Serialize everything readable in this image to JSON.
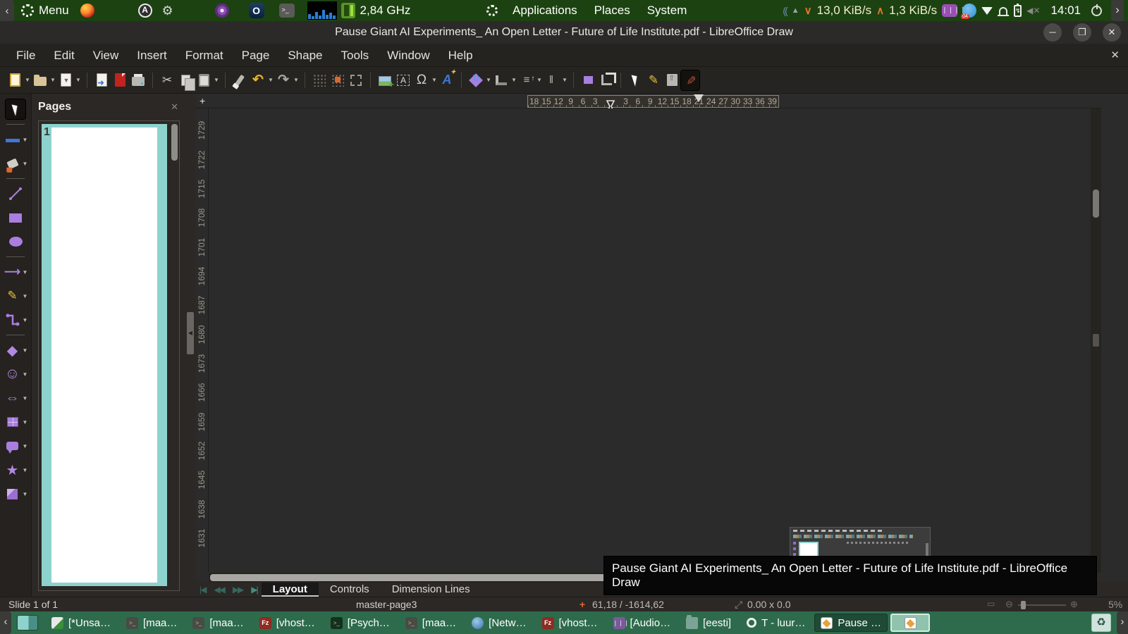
{
  "top_panel": {
    "menu_label": "Menu",
    "cpu_freq": "2,84 GHz",
    "menus": [
      "Applications",
      "Places",
      "System"
    ],
    "net_down": "13,0 KiB/s",
    "net_up": "1,3 KiB/s",
    "clock": "14:01"
  },
  "title_bar": {
    "title": "Pause Giant AI Experiments_ An Open Letter - Future of Life Institute.pdf - LibreOffice Draw"
  },
  "menu_bar": {
    "items": [
      "File",
      "Edit",
      "View",
      "Insert",
      "Format",
      "Page",
      "Shape",
      "Tools",
      "Window",
      "Help"
    ]
  },
  "icons": {
    "chevron_left": "‹",
    "chevron_right": "›",
    "search_letter": "A",
    "gears": "⚙",
    "terminal_prompt": ">_",
    "opera_letter": "O",
    "scissors": "✂",
    "undo": "↶",
    "redo": "↷",
    "omega": "Ω",
    "fontwork_letter": "A",
    "textbox_letter": "A",
    "arrange": "≡",
    "distribute": "‖",
    "pencil": "✎",
    "line_arrow": "⟶",
    "diamond": "◆",
    "smiley": "☺",
    "double_arrow": "⇔",
    "star": "★",
    "mute": "◀✕",
    "close": "✕",
    "minimize": "─",
    "restore": "❐",
    "nav_first": "|◀",
    "nav_prev": "◀◀",
    "nav_next": "▶▶",
    "nav_last": "▶|",
    "filezilla": "Fz",
    "trash": "♻",
    "size_icon": "⤢",
    "pos_cross": "+",
    "zoom_fit": "▭",
    "zoom_minus": "⊖",
    "zoom_plus": "⊕",
    "split_arrow": "◀"
  },
  "rulers": {
    "horizontal": [
      "18",
      "15",
      "12",
      "9",
      "6",
      "3",
      "3",
      "6",
      "9",
      "12",
      "15",
      "18",
      "21",
      "24",
      "27",
      "30",
      "33",
      "36",
      "39"
    ],
    "vertical": [
      "1729",
      "1722",
      "1715",
      "1708",
      "1701",
      "1694",
      "1687",
      "1680",
      "1673",
      "1666",
      "1659",
      "1652",
      "1645",
      "1638",
      "1631"
    ]
  },
  "pages_panel": {
    "title": "Pages",
    "page_number": "1"
  },
  "view_tabs": {
    "items": [
      "Layout",
      "Controls",
      "Dimension Lines"
    ],
    "active": "Layout"
  },
  "status_bar": {
    "slide": "Slide 1 of 1",
    "master": "master-page3",
    "position": "61,18 / -1614,62",
    "size": "0.00 x 0.0",
    "zoom": "5%"
  },
  "tooltip": {
    "text": "Pause Giant AI Experiments_ An Open Letter - Future of Life Institute.pdf - LibreOffice Draw"
  },
  "taskbar": {
    "items": [
      {
        "icon": "text-editor",
        "label": "[*Unsa…"
      },
      {
        "icon": "terminal",
        "label": "[maa…"
      },
      {
        "icon": "terminal",
        "label": "[maa…"
      },
      {
        "icon": "filezilla",
        "label": "[vhost…"
      },
      {
        "icon": "terminal-dark",
        "label": "[Psych…"
      },
      {
        "icon": "terminal",
        "label": "[maa…"
      },
      {
        "icon": "network",
        "label": "[Netw…"
      },
      {
        "icon": "filezilla",
        "label": "[vhost…"
      },
      {
        "icon": "audio",
        "label": "[Audio…"
      },
      {
        "icon": "folder",
        "label": "[eesti]"
      },
      {
        "icon": "opera",
        "label": "T - luur…"
      },
      {
        "icon": "draw-document",
        "label": "Pause …"
      }
    ]
  }
}
